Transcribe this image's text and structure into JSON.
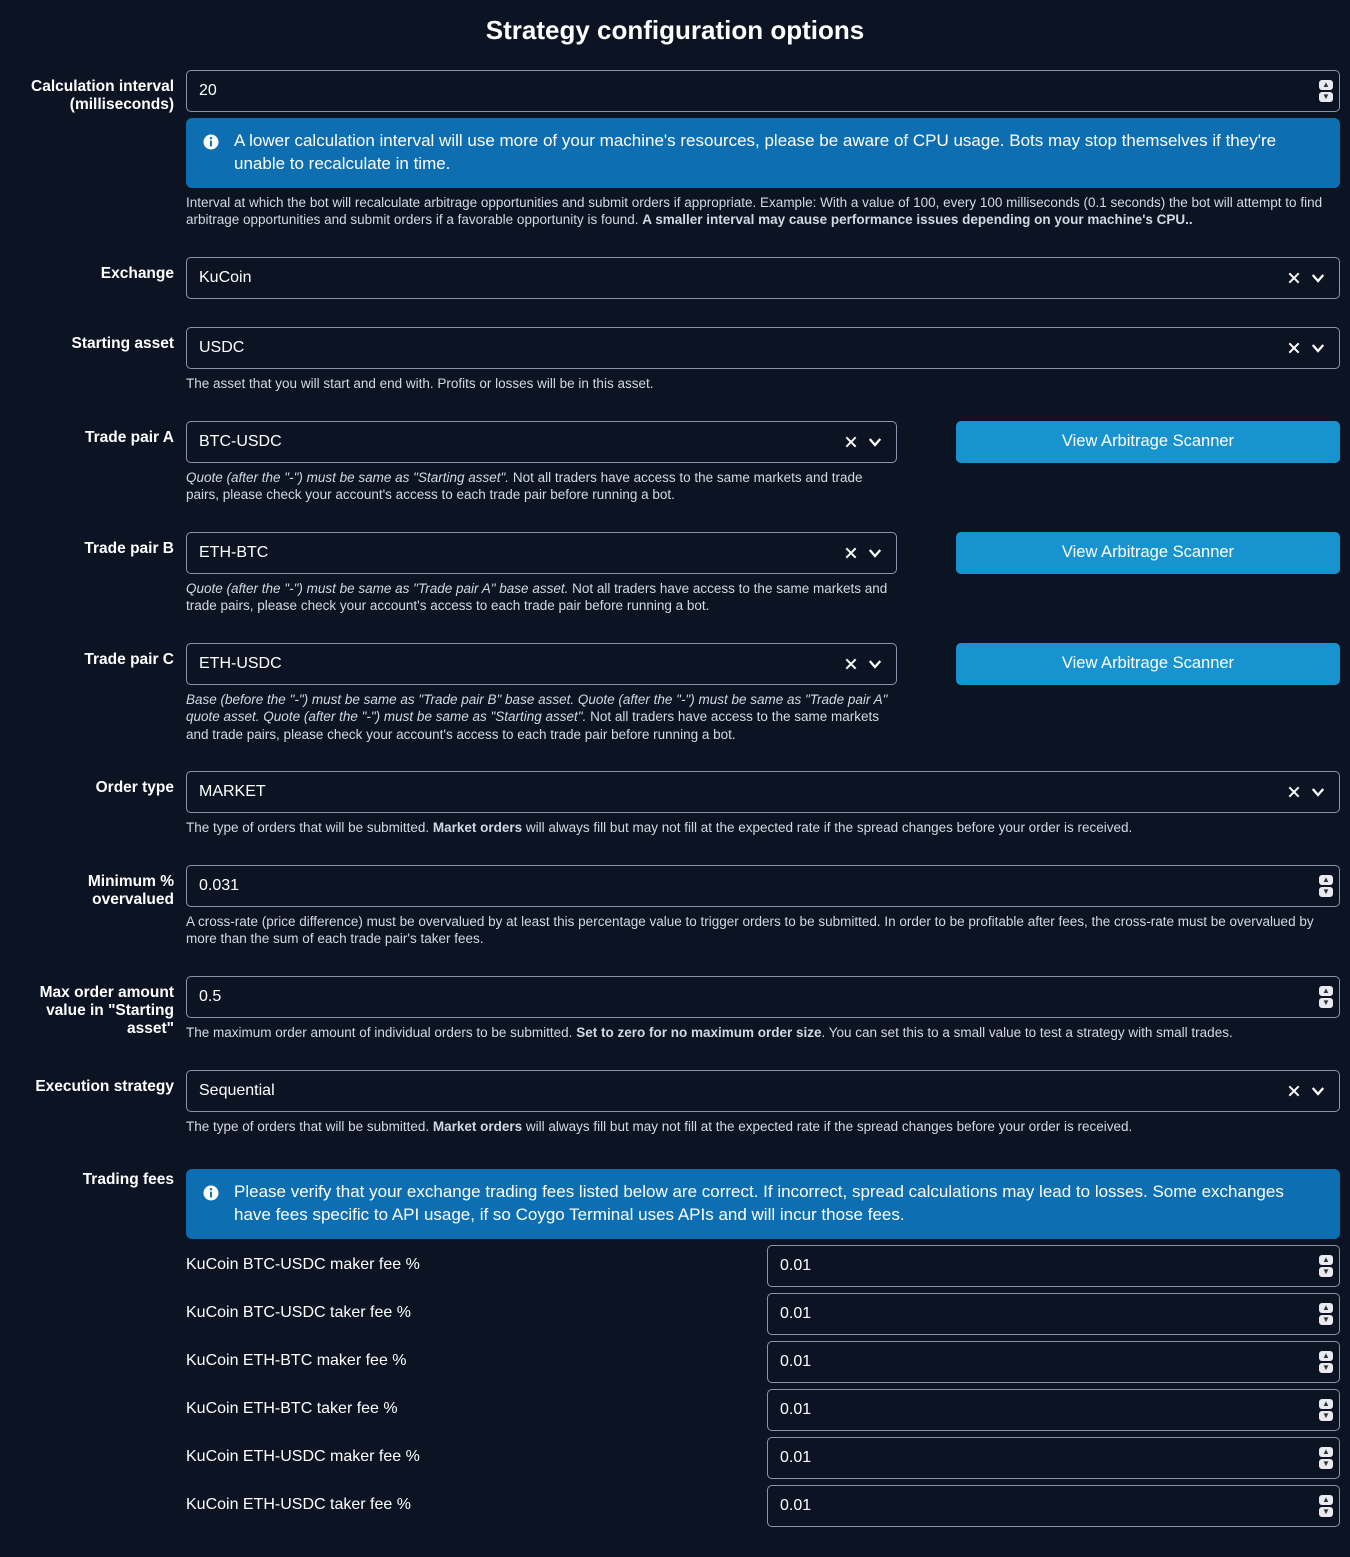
{
  "title": "Strategy configuration options",
  "calcInterval": {
    "label": "Calculation interval (milliseconds)",
    "value": "20",
    "banner": "A lower calculation interval will use more of your machine's resources, please be aware of CPU usage. Bots may stop themselves if they're unable to recalculate in time.",
    "help1": "Interval at which the bot will recalculate arbitrage opportunities and submit orders if appropriate. Example: With a value of 100, every 100 milliseconds (0.1 seconds) the bot will attempt to find arbitrage opportunities and submit orders if a favorable opportunity is found. ",
    "help1b": "A smaller interval may cause performance issues depending on your machine's CPU.."
  },
  "exchange": {
    "label": "Exchange",
    "value": "KuCoin"
  },
  "startingAsset": {
    "label": "Starting asset",
    "value": "USDC",
    "help": "The asset that you will start and end with. Profits or losses will be in this asset."
  },
  "scannerBtn": "View Arbitrage Scanner",
  "tradePairA": {
    "label": "Trade pair A",
    "value": "BTC-USDC",
    "helpEm": "Quote (after the \"-\") must be same as \"Starting asset\".",
    "helpRest": " Not all traders have access to the same markets and trade pairs, please check your account's access to each trade pair before running a bot."
  },
  "tradePairB": {
    "label": "Trade pair B",
    "value": "ETH-BTC",
    "helpEm": "Quote (after the \"-\") must be same as \"Trade pair A\" base asset.",
    "helpRest": " Not all traders have access to the same markets and trade pairs, please check your account's access to each trade pair before running a bot."
  },
  "tradePairC": {
    "label": "Trade pair C",
    "value": "ETH-USDC",
    "helpEm": "Base (before the \"-\") must be same as \"Trade pair B\" base asset. Quote (after the \"-\") must be same as \"Trade pair A\" quote asset. Quote (after the \"-\") must be same as \"Starting asset\".",
    "helpRest": " Not all traders have access to the same markets and trade pairs, please check your account's access to each trade pair before running a bot."
  },
  "orderType": {
    "label": "Order type",
    "value": "MARKET",
    "help1": "The type of orders that will be submitted. ",
    "help1b": "Market orders",
    "help1c": " will always fill but may not fill at the expected rate if the spread changes before your order is received."
  },
  "minOver": {
    "label": "Minimum % overvalued",
    "value": "0.031",
    "help": "A cross-rate (price difference) must be overvalued by at least this percentage value to trigger orders to be submitted. In order to be profitable after fees, the cross-rate must be overvalued by more than the sum of each trade pair's taker fees."
  },
  "maxOrder": {
    "label": "Max order amount value in \"Starting asset\"",
    "value": "0.5",
    "help1": "The maximum order amount of individual orders to be submitted. ",
    "help1b": "Set to zero for no maximum order size",
    "help1c": ". You can set this to a small value to test a strategy with small trades."
  },
  "execStrategy": {
    "label": "Execution strategy",
    "value": "Sequential",
    "help1": "The type of orders that will be submitted. ",
    "help1b": "Market orders",
    "help1c": " will always fill but may not fill at the expected rate if the spread changes before your order is received."
  },
  "tradingFees": {
    "label": "Trading fees",
    "banner": "Please verify that your exchange trading fees listed below are correct. If incorrect, spread calculations may lead to losses. Some exchanges have fees specific to API usage, if so Coygo Terminal uses APIs and will incur those fees.",
    "rows": [
      {
        "label": "KuCoin BTC-USDC maker fee %",
        "value": "0.01"
      },
      {
        "label": "KuCoin BTC-USDC taker fee %",
        "value": "0.01"
      },
      {
        "label": "KuCoin ETH-BTC maker fee %",
        "value": "0.01"
      },
      {
        "label": "KuCoin ETH-BTC taker fee %",
        "value": "0.01"
      },
      {
        "label": "KuCoin ETH-USDC maker fee %",
        "value": "0.01"
      },
      {
        "label": "KuCoin ETH-USDC taker fee %",
        "value": "0.01"
      }
    ]
  }
}
